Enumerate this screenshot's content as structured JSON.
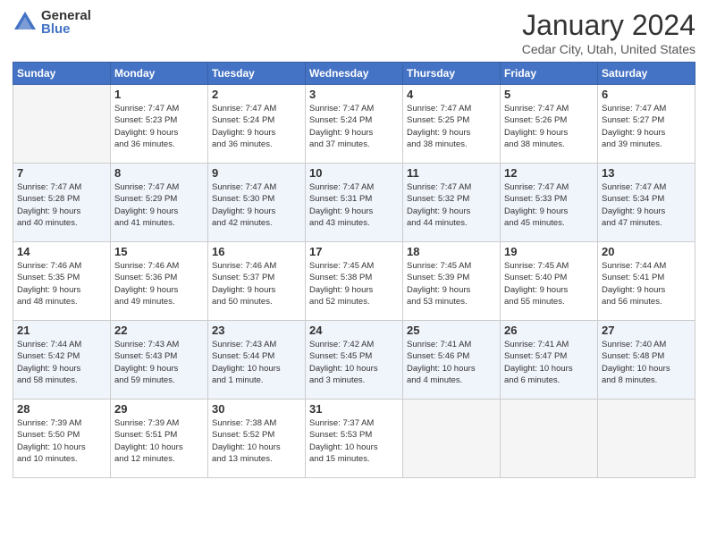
{
  "header": {
    "logo_general": "General",
    "logo_blue": "Blue",
    "title": "January 2024",
    "subtitle": "Cedar City, Utah, United States"
  },
  "columns": [
    "Sunday",
    "Monday",
    "Tuesday",
    "Wednesday",
    "Thursday",
    "Friday",
    "Saturday"
  ],
  "weeks": [
    [
      {
        "num": "",
        "info": ""
      },
      {
        "num": "1",
        "info": "Sunrise: 7:47 AM\nSunset: 5:23 PM\nDaylight: 9 hours\nand 36 minutes."
      },
      {
        "num": "2",
        "info": "Sunrise: 7:47 AM\nSunset: 5:24 PM\nDaylight: 9 hours\nand 36 minutes."
      },
      {
        "num": "3",
        "info": "Sunrise: 7:47 AM\nSunset: 5:24 PM\nDaylight: 9 hours\nand 37 minutes."
      },
      {
        "num": "4",
        "info": "Sunrise: 7:47 AM\nSunset: 5:25 PM\nDaylight: 9 hours\nand 38 minutes."
      },
      {
        "num": "5",
        "info": "Sunrise: 7:47 AM\nSunset: 5:26 PM\nDaylight: 9 hours\nand 38 minutes."
      },
      {
        "num": "6",
        "info": "Sunrise: 7:47 AM\nSunset: 5:27 PM\nDaylight: 9 hours\nand 39 minutes."
      }
    ],
    [
      {
        "num": "7",
        "info": "Sunrise: 7:47 AM\nSunset: 5:28 PM\nDaylight: 9 hours\nand 40 minutes."
      },
      {
        "num": "8",
        "info": "Sunrise: 7:47 AM\nSunset: 5:29 PM\nDaylight: 9 hours\nand 41 minutes."
      },
      {
        "num": "9",
        "info": "Sunrise: 7:47 AM\nSunset: 5:30 PM\nDaylight: 9 hours\nand 42 minutes."
      },
      {
        "num": "10",
        "info": "Sunrise: 7:47 AM\nSunset: 5:31 PM\nDaylight: 9 hours\nand 43 minutes."
      },
      {
        "num": "11",
        "info": "Sunrise: 7:47 AM\nSunset: 5:32 PM\nDaylight: 9 hours\nand 44 minutes."
      },
      {
        "num": "12",
        "info": "Sunrise: 7:47 AM\nSunset: 5:33 PM\nDaylight: 9 hours\nand 45 minutes."
      },
      {
        "num": "13",
        "info": "Sunrise: 7:47 AM\nSunset: 5:34 PM\nDaylight: 9 hours\nand 47 minutes."
      }
    ],
    [
      {
        "num": "14",
        "info": "Sunrise: 7:46 AM\nSunset: 5:35 PM\nDaylight: 9 hours\nand 48 minutes."
      },
      {
        "num": "15",
        "info": "Sunrise: 7:46 AM\nSunset: 5:36 PM\nDaylight: 9 hours\nand 49 minutes."
      },
      {
        "num": "16",
        "info": "Sunrise: 7:46 AM\nSunset: 5:37 PM\nDaylight: 9 hours\nand 50 minutes."
      },
      {
        "num": "17",
        "info": "Sunrise: 7:45 AM\nSunset: 5:38 PM\nDaylight: 9 hours\nand 52 minutes."
      },
      {
        "num": "18",
        "info": "Sunrise: 7:45 AM\nSunset: 5:39 PM\nDaylight: 9 hours\nand 53 minutes."
      },
      {
        "num": "19",
        "info": "Sunrise: 7:45 AM\nSunset: 5:40 PM\nDaylight: 9 hours\nand 55 minutes."
      },
      {
        "num": "20",
        "info": "Sunrise: 7:44 AM\nSunset: 5:41 PM\nDaylight: 9 hours\nand 56 minutes."
      }
    ],
    [
      {
        "num": "21",
        "info": "Sunrise: 7:44 AM\nSunset: 5:42 PM\nDaylight: 9 hours\nand 58 minutes."
      },
      {
        "num": "22",
        "info": "Sunrise: 7:43 AM\nSunset: 5:43 PM\nDaylight: 9 hours\nand 59 minutes."
      },
      {
        "num": "23",
        "info": "Sunrise: 7:43 AM\nSunset: 5:44 PM\nDaylight: 10 hours\nand 1 minute."
      },
      {
        "num": "24",
        "info": "Sunrise: 7:42 AM\nSunset: 5:45 PM\nDaylight: 10 hours\nand 3 minutes."
      },
      {
        "num": "25",
        "info": "Sunrise: 7:41 AM\nSunset: 5:46 PM\nDaylight: 10 hours\nand 4 minutes."
      },
      {
        "num": "26",
        "info": "Sunrise: 7:41 AM\nSunset: 5:47 PM\nDaylight: 10 hours\nand 6 minutes."
      },
      {
        "num": "27",
        "info": "Sunrise: 7:40 AM\nSunset: 5:48 PM\nDaylight: 10 hours\nand 8 minutes."
      }
    ],
    [
      {
        "num": "28",
        "info": "Sunrise: 7:39 AM\nSunset: 5:50 PM\nDaylight: 10 hours\nand 10 minutes."
      },
      {
        "num": "29",
        "info": "Sunrise: 7:39 AM\nSunset: 5:51 PM\nDaylight: 10 hours\nand 12 minutes."
      },
      {
        "num": "30",
        "info": "Sunrise: 7:38 AM\nSunset: 5:52 PM\nDaylight: 10 hours\nand 13 minutes."
      },
      {
        "num": "31",
        "info": "Sunrise: 7:37 AM\nSunset: 5:53 PM\nDaylight: 10 hours\nand 15 minutes."
      },
      {
        "num": "",
        "info": ""
      },
      {
        "num": "",
        "info": ""
      },
      {
        "num": "",
        "info": ""
      }
    ]
  ]
}
